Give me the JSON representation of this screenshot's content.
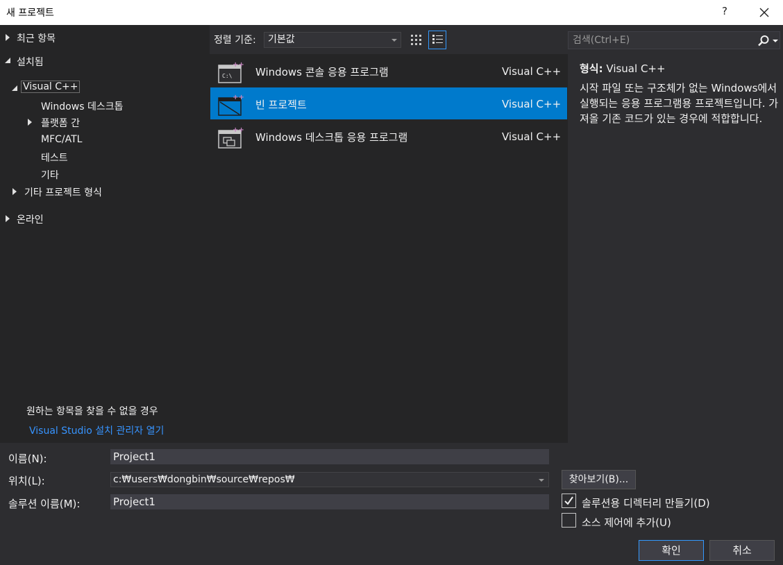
{
  "window": {
    "title": "새 프로젝트",
    "help": "?"
  },
  "tree": {
    "recent": "최근 항목",
    "installed": "설치됨",
    "visual_cpp": "Visual C++",
    "windows_desktop": "Windows 데스크톱",
    "cross_platform": "플랫폼 간",
    "mfc_atl": "MFC/ATL",
    "test": "테스트",
    "other": "기타",
    "other_project_types": "기타 프로젝트 형식",
    "online": "온라인"
  },
  "not_found": {
    "text": "원하는 항목을 찾을 수 없을 경우",
    "link": "Visual Studio 설치 관리자 열기"
  },
  "sort": {
    "label": "정렬 기준:",
    "value": "기본값"
  },
  "search": {
    "placeholder": "검색(Ctrl+E)"
  },
  "templates": [
    {
      "name": "Windows 콘솔 응용 프로그램",
      "lang": "Visual C++",
      "icon": "console-app-icon"
    },
    {
      "name": "빈 프로젝트",
      "lang": "Visual C++",
      "icon": "empty-project-icon"
    },
    {
      "name": "Windows 데스크톱 응용 프로그램",
      "lang": "Visual C++",
      "icon": "desktop-app-icon"
    }
  ],
  "description": {
    "type_label": "형식:",
    "type_value": "Visual C++",
    "text": "시작 파일 또는 구조체가 없는 Windows에서 실행되는 응용 프로그램용 프로젝트입니다. 가져올 기존 코드가 있는 경우에 적합합니다."
  },
  "form": {
    "name_label": "이름(N):",
    "name_value": "Project1",
    "location_label": "위치(L):",
    "location_value": "c:₩users₩dongbin₩source₩repos₩",
    "solution_label": "솔루션 이름(M):",
    "solution_value": "Project1",
    "browse": "찾아보기(B)...",
    "create_dir_label": "솔루션용 디렉터리 만들기(D)",
    "create_dir_checked": true,
    "source_control_label": "소스 제어에 추가(U)",
    "source_control_checked": false,
    "ok": "확인",
    "cancel": "취소"
  },
  "colors": {
    "accent": "#007acc",
    "link": "#3794ff",
    "background": "#2d2d30",
    "panel": "#252526"
  }
}
